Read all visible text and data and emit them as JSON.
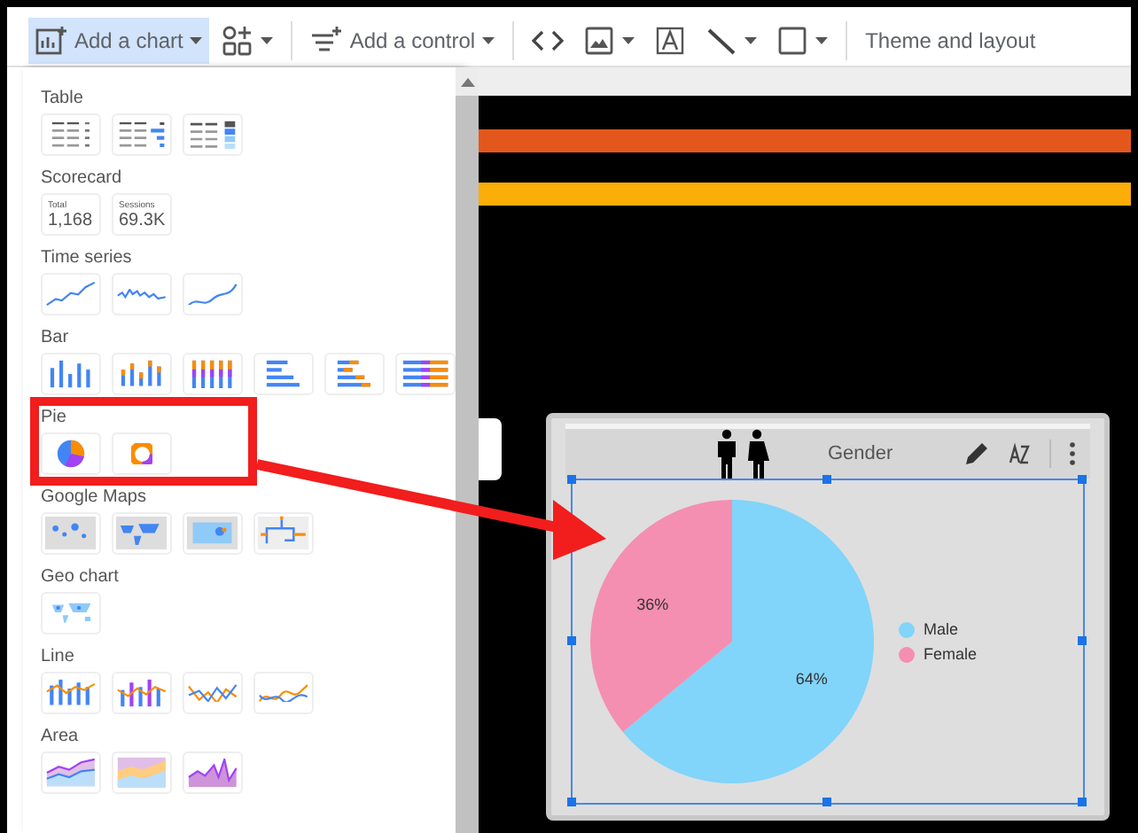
{
  "toolbar": [
    {
      "kind": "add-chart",
      "label": "Add a chart",
      "caret": true,
      "selected": true,
      "divider_after": false
    },
    {
      "kind": "components",
      "caret": true,
      "selected": false,
      "divider_after": true
    },
    {
      "kind": "add-control",
      "label": "Add a control",
      "caret": true,
      "selected": false,
      "divider_after": true
    },
    {
      "kind": "code",
      "caret": false,
      "selected": false,
      "divider_after": false
    },
    {
      "kind": "image",
      "caret": true,
      "selected": false,
      "divider_after": false
    },
    {
      "kind": "textbox",
      "caret": false,
      "selected": false,
      "divider_after": false
    },
    {
      "kind": "line",
      "caret": true,
      "selected": false,
      "divider_after": false
    },
    {
      "kind": "shape",
      "caret": true,
      "selected": false,
      "divider_after": true
    },
    {
      "kind": "theme",
      "label": "Theme and layout",
      "caret": false,
      "selected": false,
      "divider_after": false
    }
  ],
  "chart_menu": {
    "sections": [
      {
        "label": "Table",
        "items": [
          {
            "kind": "table"
          },
          {
            "kind": "table-bars"
          },
          {
            "kind": "table-heatmap"
          }
        ]
      },
      {
        "label": "Scorecard",
        "items": [
          {
            "kind": "scorecard",
            "label": "Total",
            "value": "1,168"
          },
          {
            "kind": "scorecard",
            "label": "Sessions",
            "value": "69.3K"
          }
        ]
      },
      {
        "label": "Time series",
        "items": [
          {
            "kind": "timeseries"
          },
          {
            "kind": "sparkline"
          },
          {
            "kind": "smoothed"
          }
        ]
      },
      {
        "label": "Bar",
        "items": [
          {
            "kind": "column"
          },
          {
            "kind": "stacked-column"
          },
          {
            "kind": "full-column"
          },
          {
            "kind": "bar"
          },
          {
            "kind": "stacked-bar"
          },
          {
            "kind": "full-bar"
          }
        ]
      },
      {
        "label": "Pie",
        "items": [
          {
            "kind": "pie"
          },
          {
            "kind": "donut"
          }
        ]
      },
      {
        "label": "Google Maps",
        "items": [
          {
            "kind": "bubble-map"
          },
          {
            "kind": "filled-map"
          },
          {
            "kind": "heat-map"
          },
          {
            "kind": "line-map"
          }
        ]
      },
      {
        "label": "Geo chart",
        "items": [
          {
            "kind": "geo"
          }
        ]
      },
      {
        "label": "Line",
        "items": [
          {
            "kind": "combo"
          },
          {
            "kind": "stacked-combo"
          },
          {
            "kind": "line"
          },
          {
            "kind": "smooth-line"
          }
        ]
      },
      {
        "label": "Area",
        "items": [
          {
            "kind": "area"
          },
          {
            "kind": "stacked-area"
          },
          {
            "kind": "full-area"
          }
        ]
      }
    ]
  },
  "card": {
    "title": "Gender",
    "selected": true,
    "chart_data": {
      "type": "pie",
      "categories": [
        "Male",
        "Female"
      ],
      "values": [
        64,
        36
      ],
      "colors": [
        "#81d4fa",
        "#f48fb1"
      ],
      "value_labels": [
        "64%",
        "36%"
      ],
      "legend": "right"
    }
  }
}
